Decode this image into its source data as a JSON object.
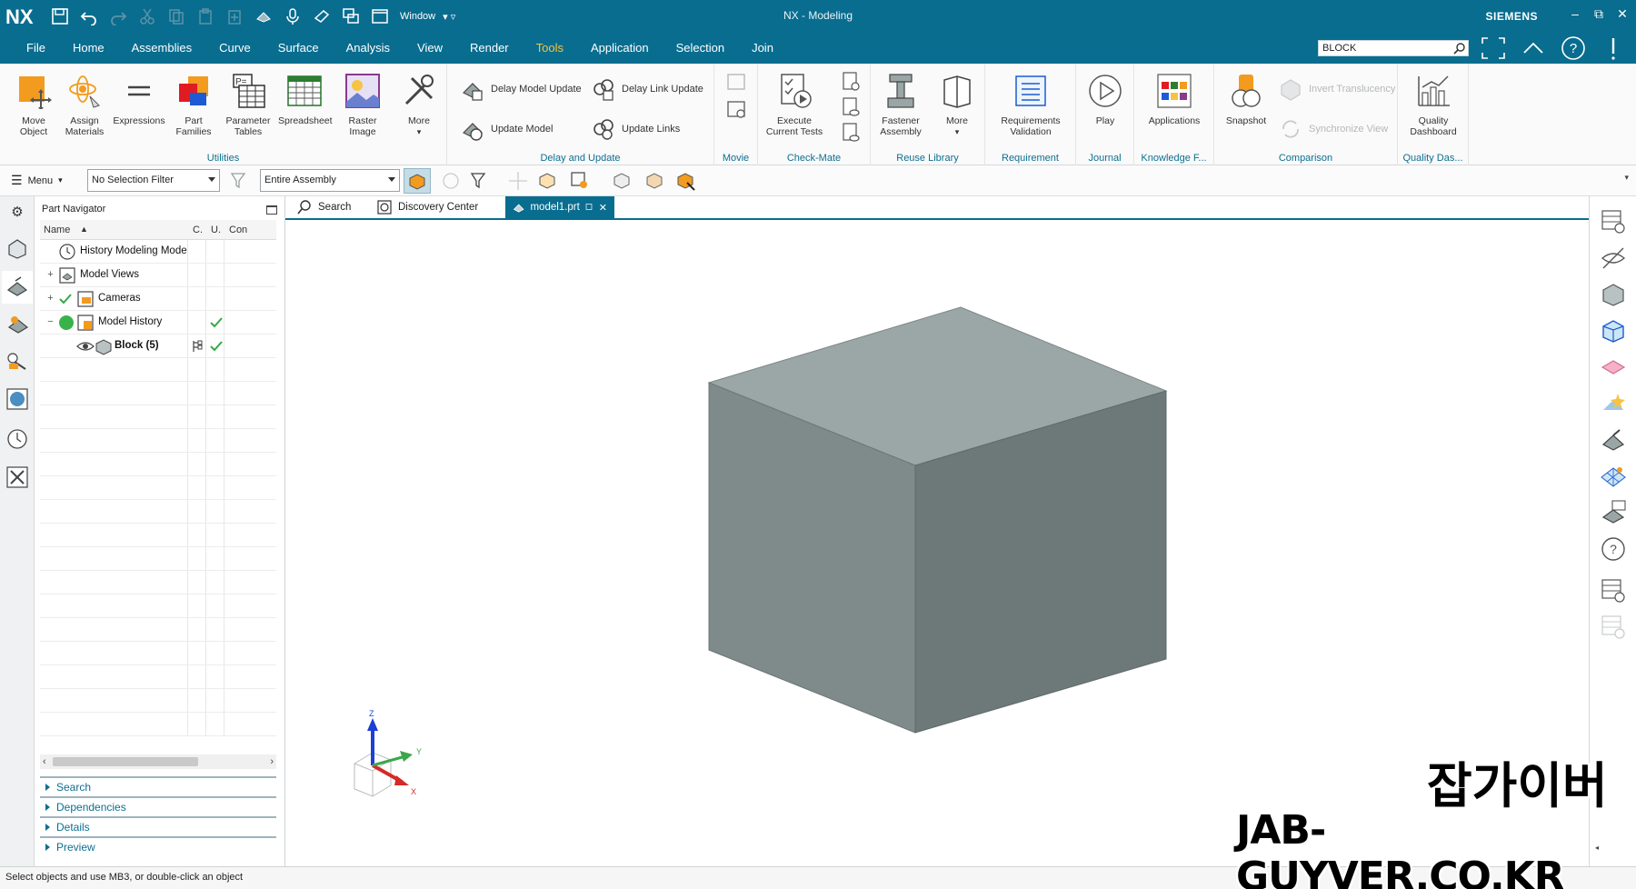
{
  "window": {
    "app_logo": "NX",
    "title": "NX - Modeling",
    "brand": "SIEMENS",
    "qat_window_label": "Window",
    "controls": [
      "minimize",
      "restore",
      "close"
    ]
  },
  "menu": {
    "tabs": [
      "File",
      "Home",
      "Assemblies",
      "Curve",
      "Surface",
      "Analysis",
      "View",
      "Render",
      "Tools",
      "Application",
      "Selection",
      "Join"
    ],
    "active_tab": "Tools",
    "command_search_value": "BLOCK"
  },
  "ribbon": {
    "utilities": {
      "label": "Utilities",
      "buttons": [
        {
          "label": "Move Object"
        },
        {
          "label": "Assign Materials"
        },
        {
          "label": "Expressions"
        },
        {
          "label": "Part Families"
        },
        {
          "label": "Parameter Tables"
        },
        {
          "label": "Spreadsheet"
        },
        {
          "label": "Raster Image"
        },
        {
          "label": "More"
        }
      ]
    },
    "delay_update": {
      "label": "Delay and Update",
      "items": [
        "Delay Model Update",
        "Delay Link Update",
        "Update Model",
        "Update Links"
      ]
    },
    "movie": {
      "label": "Movie"
    },
    "check_mate": {
      "label": "Check-Mate",
      "execute": "Execute Current Tests"
    },
    "reuse_library": {
      "label": "Reuse Library",
      "fastener": "Fastener Assembly",
      "more": "More"
    },
    "requirement": {
      "label": "Requirement",
      "req_validation": "Requirements Validation"
    },
    "journal": {
      "label": "Journal",
      "play": "Play"
    },
    "knowledge": {
      "label": "Knowledge F...",
      "applications": "Applications"
    },
    "comparison": {
      "label": "Comparison",
      "snapshot": "Snapshot",
      "invert": "Invert Translucency",
      "sync": "Synchronize View"
    },
    "quality": {
      "label": "Quality Das...",
      "dashboard": "Quality Dashboard"
    }
  },
  "selection_bar": {
    "menu_label": "Menu",
    "filter_value": "No Selection Filter",
    "scope_value": "Entire Assembly"
  },
  "navigator": {
    "title": "Part Navigator",
    "columns": [
      "Name",
      "C.",
      "U.",
      "Con"
    ],
    "rows": [
      {
        "name": "History Modeling Mode",
        "expander": "",
        "bold": false
      },
      {
        "name": "Model Views",
        "expander": "+",
        "bold": false
      },
      {
        "name": "Cameras",
        "expander": "+",
        "bold": false
      },
      {
        "name": "Model History",
        "expander": "−",
        "bold": false
      },
      {
        "name": "Block (5)",
        "expander": "",
        "bold": true
      }
    ],
    "panels": [
      "Search",
      "Dependencies",
      "Details",
      "Preview"
    ]
  },
  "doc_tabs": [
    {
      "label": "Search",
      "active": false
    },
    {
      "label": "Discovery Center",
      "active": false
    },
    {
      "label": "model1.prt",
      "active": true
    }
  ],
  "triad": {
    "x": "X",
    "y": "Y",
    "z": "Z"
  },
  "status": {
    "prompt": "Select objects and use MB3, or double-click an object"
  },
  "watermark": {
    "korean": "잡가이버",
    "domain": "JAB-GUYVER.CO.KR"
  },
  "colors": {
    "accent": "#096d8f",
    "active_tab": "#f6c343",
    "cube_top": "#9aa6a6",
    "cube_left": "#7f8a8a",
    "cube_right": "#6c7777"
  }
}
